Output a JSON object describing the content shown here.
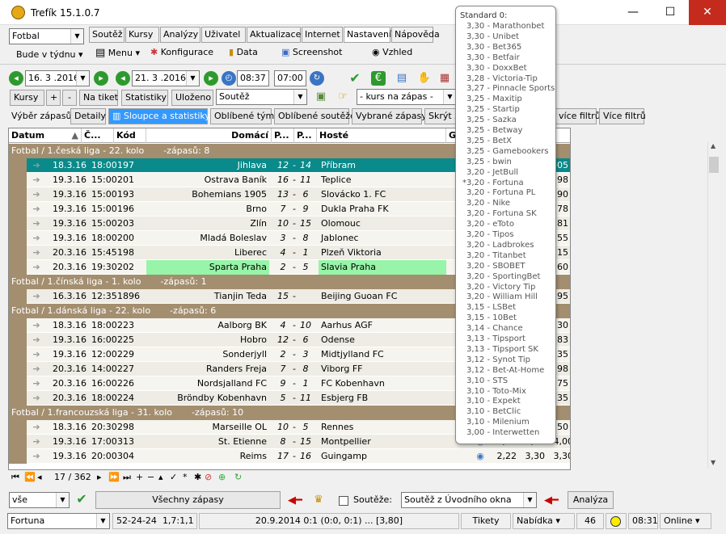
{
  "app": {
    "title": "Trefík 15.1.0.7"
  },
  "window": {
    "min_icon": "minimize-icon",
    "max_icon": "maximize-icon",
    "close_icon": "close-icon"
  },
  "toolbar1": {
    "sport": "Fotbal",
    "period": "Bude v týdnu",
    "tabs": [
      "Soutěž",
      "Kursy",
      "Analýzy",
      "Uživatel",
      "Aktualizace",
      "Internet",
      "Nastavení",
      "Nápověda"
    ],
    "menu": "Menu",
    "konfig": "Konfigurace",
    "data": "Data",
    "screenshot": "Screenshot",
    "vzhled": "Vzhled"
  },
  "toolbar2": {
    "date_from": "16. 3 .2016",
    "date_to": "21. 3 .2016",
    "time_from": "08:37",
    "time_to": "07:00"
  },
  "toolbar3": {
    "kursy": "Kursy",
    "plus": "+",
    "minus": "-",
    "natiket": "Na tiket",
    "statistiky": "Statistiky",
    "ulozeno": "Uloženo",
    "soutez": "Soutěž",
    "kurs_placeholder": "- kurs na zápas -"
  },
  "toolbar4": {
    "tabs": [
      "Výběr zápasů",
      "Detaily",
      "Sloupce a statistiky",
      "Oblíbené týmy",
      "Oblíbené soutěže",
      "Vybrané zápasy",
      "Skrýt zá"
    ],
    "vice1": "více filtrů",
    "vice2": "Více filtrů"
  },
  "grid": {
    "columns": [
      "Datum",
      "Č...",
      "Kód",
      "Domácí",
      "P...",
      "P...",
      "Hosté",
      "G"
    ],
    "groups": [
      {
        "label": "Fotbal / 1.česká liga - 22. kolo",
        "count": "-zápasů: 8",
        "rows": [
          [
            "18.3.16",
            "18:00",
            "197",
            "Jihlava",
            "12",
            "14",
            "Příbram",
            "3,05"
          ],
          [
            "19.3.16",
            "15:00",
            "201",
            "Ostrava Baník",
            "16",
            "11",
            "Teplice",
            "1,98"
          ],
          [
            "19.3.16",
            "15:00",
            "193",
            "Bohemians 1905",
            "13",
            "6",
            "Slovácko 1. FC",
            "2,90"
          ],
          [
            "19.3.16",
            "15:00",
            "196",
            "Brno",
            "7",
            "9",
            "Dukla Praha FK",
            "2,78"
          ],
          [
            "19.3.16",
            "15:00",
            "203",
            "Zlín",
            "10",
            "15",
            "Olomouc",
            "2,81"
          ],
          [
            "19.3.16",
            "18:00",
            "200",
            "Mladá Boleslav",
            "3",
            "8",
            "Jablonec",
            "2,55"
          ],
          [
            "20.3.16",
            "15:45",
            "198",
            "Liberec",
            "4",
            "1",
            "Plzeň Viktoria",
            "2,15"
          ],
          [
            "20.3.16",
            "19:30",
            "202",
            "Sparta Praha",
            "2",
            "5",
            "Slavia Praha",
            "2,60"
          ]
        ]
      },
      {
        "label": "Fotbal / 1.čínská liga - 1. kolo",
        "count": "-zápasů: 1",
        "rows": [
          [
            "16.3.16",
            "12:35",
            "1896",
            "Tianjin Teda",
            "15",
            "",
            "Beijing Guoan FC",
            "2,95"
          ]
        ]
      },
      {
        "label": "Fotbal / 1.dánská liga - 22. kolo",
        "count": "-zápasů: 6",
        "rows": [
          [
            "18.3.16",
            "18:00",
            "223",
            "Aalborg BK",
            "4",
            "10",
            "Aarhus AGF",
            "3,30"
          ],
          [
            "19.3.16",
            "16:00",
            "225",
            "Hobro",
            "12",
            "6",
            "Odense",
            "2,83"
          ],
          [
            "19.3.16",
            "12:00",
            "229",
            "Sonderjyll",
            "2",
            "3",
            "Midtjylland FC",
            "2,35"
          ],
          [
            "20.3.16",
            "14:00",
            "227",
            "Randers Freja",
            "7",
            "8",
            "Viborg FF",
            "2,98"
          ],
          [
            "20.3.16",
            "16:00",
            "226",
            "Nordsjalland FC",
            "9",
            "1",
            "FC Kobenhavn",
            "2,75"
          ],
          [
            "20.3.16",
            "18:00",
            "224",
            "Bröndby Kobenhavn",
            "5",
            "11",
            "Esbjerg FB",
            "2,35"
          ]
        ]
      },
      {
        "label": "Fotbal / 1.francouzská liga - 31. kolo",
        "count": "-zápasů: 10",
        "rows": [
          [
            "18.3.16",
            "20:30",
            "298",
            "Marseille OL",
            "10",
            "5",
            "Rennes",
            "2,50"
          ],
          [
            "19.3.16",
            "17:00",
            "313",
            "St. Etienne",
            "8",
            "15",
            "Montpellier",
            "1,98",
            "3,20",
            "4,00"
          ],
          [
            "19.3.16",
            "20:00",
            "304",
            "Reims",
            "17",
            "16",
            "Guingamp",
            "2,22",
            "3,30",
            "3,30"
          ]
        ]
      }
    ]
  },
  "navbar": {
    "counter": "17 / 362"
  },
  "bottom": {
    "filter": "vše",
    "vsechny": "Všechny zápasy",
    "souteze": "Soutěže:",
    "souteze_value": "Soutěž z Úvodního okna",
    "analyza": "Analýza"
  },
  "statusbar": {
    "bookie": "Fortuna",
    "stat1": "52-24-24",
    "stat2": "1,7:1,1",
    "match": "20.9.2014 0:1 (0:0, 0:1) ... [3,80]",
    "tikety": "Tikety",
    "nabidka": "Nabídka",
    "count": "46",
    "time": "08:31",
    "online": "Online"
  },
  "popup": {
    "header": "Standard     0:",
    "items": [
      "3,30 - Marathonbet",
      "3,30 - Unibet",
      "3,30 - Bet365",
      "3,30 - Betfair",
      "3,30 - DoxxBet",
      "3,28 - Victoria-Tip",
      "3,27 - Pinnacle Sports",
      "3,25 - Maxitip",
      "3,25 - Startip",
      "3,25 - Sazka",
      "3,25 - Betway",
      "3,25 - BetX",
      "3,25 - Gamebookers",
      "3,25 - bwin",
      "3,20 - JetBull",
      "3,20 - Fortuna",
      "3,20 - Fortuna PL",
      "3,20 - Nike",
      "3,20 - Fortuna SK",
      "3,20 - eToto",
      "3,20 - Tipos",
      "3,20 - Ladbrokes",
      "3,20 - Titanbet",
      "3,20 - SBOBET",
      "3,20 - SportingBet",
      "3,20 - Victory Tip",
      "3,20 - William Hill",
      "3,15 - LSBet",
      "3,15 - 10Bet",
      "3,14 - Chance",
      "3,13 - Tipsport",
      "3,13 - Tipsport SK",
      "3,12 - Synot Tip",
      "3,12 - Bet-At-Home",
      "3,10 - STS",
      "3,10 - Toto-Mix",
      "3,10 - Expekt",
      "3,10 - BetClic",
      "3,10 - Milenium",
      "3,00 - Interwetten"
    ],
    "marked_index": 15,
    "marker": "*"
  }
}
